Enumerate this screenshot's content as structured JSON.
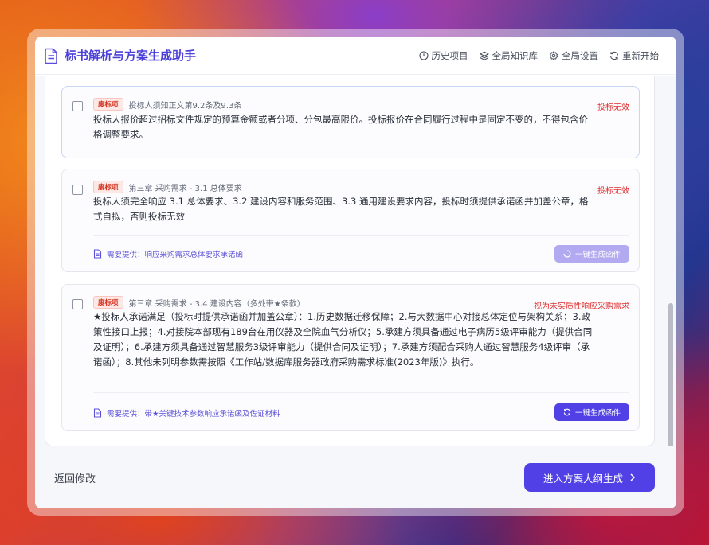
{
  "app": {
    "title": "标书解析与方案生成助手"
  },
  "nav": [
    {
      "label": "历史项目",
      "icon": "clock-icon"
    },
    {
      "label": "全局知识库",
      "icon": "layers-icon"
    },
    {
      "label": "全局设置",
      "icon": "gear-icon"
    },
    {
      "label": "重新开始",
      "icon": "refresh-icon"
    }
  ],
  "cards": [
    {
      "tag": "废标项",
      "source": "投标人须知正文第9.2条及9.3条",
      "status": "投标无效",
      "text": "投标人报价超过招标文件规定的预算金额或者分项、分包最高限价。投标报价在合同履行过程中是固定不变的，不得包含价格调整要求。"
    },
    {
      "tag": "废标项",
      "source": "第三章 采购需求 - 3.1 总体要求",
      "status": "投标无效",
      "text": "投标人须完全响应 3.1 总体要求、3.2 建设内容和服务范围、3.3 通用建设要求内容，投标时须提供承诺函并加盖公章，格式自拟，否则投标无效",
      "requirement": "需要提供：响应采购需求总体要求承诺函",
      "button": "一键生成函件"
    },
    {
      "tag": "废标项",
      "source": "第三章 采购需求 - 3.4 建设内容（多处带★条款）",
      "status": "视为未实质性响应采购需求",
      "text": "★投标人承诺满足（投标时提供承诺函并加盖公章）：1.历史数据迁移保障；2.与大数据中心对接总体定位与架构关系；3.政策性接口上报；4.对接院本部现有189台在用仪器及全院血气分析仪；5.承建方须具备通过电子病历5级评审能力（提供合同及证明）；6.承建方须具备通过智慧服务3级评审能力（提供合同及证明）；7.承建方须配合采购人通过智慧服务4级评审（承诺函）；8.其他未列明参数需按照《工作站/数据库服务器政府采购需求标准(2023年版)》执行。",
      "requirement": "需要提供：带★关键技术参数响应承诺函及佐证材料",
      "button": "一键生成函件"
    }
  ],
  "footer": {
    "back_label": "返回修改",
    "next_label": "进入方案大纲生成"
  },
  "colors": {
    "accent": "#5040e6",
    "accent_disabled": "#b1aaf1",
    "danger": "#e02b2b",
    "title": "#4b3fd9"
  }
}
